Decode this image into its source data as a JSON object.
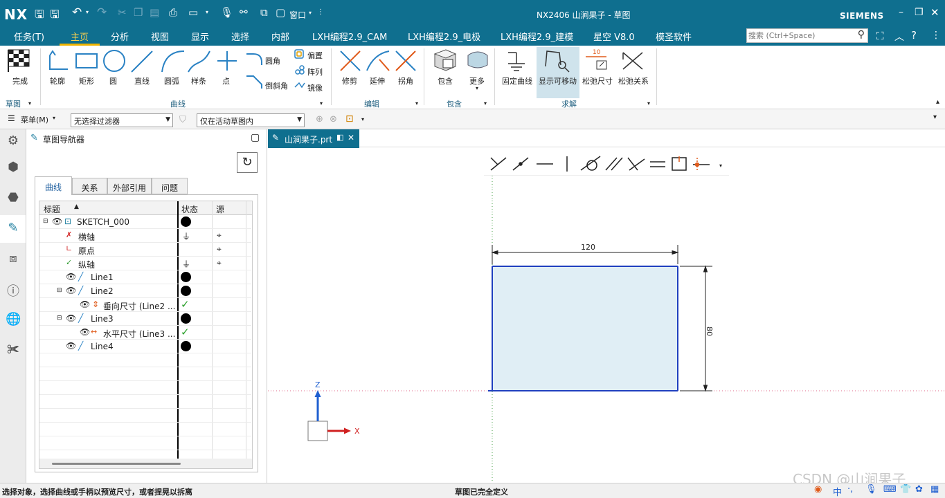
{
  "titlebar": {
    "logo": "NX",
    "window_menu": "窗口",
    "title": "NX2406 山涧果子 - 草图",
    "brand": "SIEMENS"
  },
  "menubar": {
    "tabs": [
      "任务(T)",
      "主页",
      "分析",
      "视图",
      "显示",
      "选择",
      "内部",
      "LXH编程2.9_CAM",
      "LXH编程2.9_电极",
      "LXH编程2.9_建模",
      "星空 V8.0",
      "模圣软件"
    ],
    "active_tab": "主页",
    "search_placeholder": "搜索 (Ctrl+Space)"
  },
  "ribbon": {
    "finish": "完成",
    "sketch_group": "草图",
    "curve_tools": [
      "轮廓",
      "矩形",
      "圆",
      "直线",
      "圆弧",
      "样条",
      "点"
    ],
    "fillet": "圆角",
    "chamfer": "倒斜角",
    "offset": "偏置",
    "pattern": "阵列",
    "mirror": "镜像",
    "curve_group": "曲线",
    "edit_tools": [
      "修剪",
      "延伸",
      "拐角"
    ],
    "edit_group": "编辑",
    "include": "包含",
    "more": "更多",
    "include_group": "包含",
    "solve_tools": [
      "固定曲线",
      "显示可移动",
      "松弛尺寸",
      "松弛关系"
    ],
    "solve_group": "求解",
    "relax_value": "10"
  },
  "toolbar2": {
    "menu": "菜单(M)",
    "filter": "无选择过滤器",
    "scope": "仅在活动草图内"
  },
  "navigator": {
    "title": "草图导航器",
    "tabs": [
      "曲线",
      "关系",
      "外部引用",
      "问题"
    ],
    "columns": [
      "标题",
      "状态",
      "源"
    ],
    "rows": [
      {
        "label": "SKETCH_000"
      },
      {
        "label": "横轴"
      },
      {
        "label": "原点"
      },
      {
        "label": "纵轴"
      },
      {
        "label": "Line1"
      },
      {
        "label": "Line2"
      },
      {
        "label": "垂向尺寸 (Line2 ..."
      },
      {
        "label": "Line3"
      },
      {
        "label": "水平尺寸 (Line3 ..."
      },
      {
        "label": "Line4"
      }
    ]
  },
  "viewport": {
    "file_tab": "山涧果子.prt",
    "dim_width": "120",
    "dim_height": "80",
    "axis_z": "Z",
    "axis_x": "X"
  },
  "statusbar": {
    "left": "选择对象，选择曲线或手柄以预览尺寸，或者捏晃以拆离",
    "center": "草图已完全定义",
    "watermark": "CSDN @山涧果子",
    "ime": "中"
  },
  "colors": {
    "header": "#0f6f8f",
    "sketch_blue": "#1f3fbf",
    "fill": "#e0eef5",
    "check_green": "#2aa02a"
  }
}
